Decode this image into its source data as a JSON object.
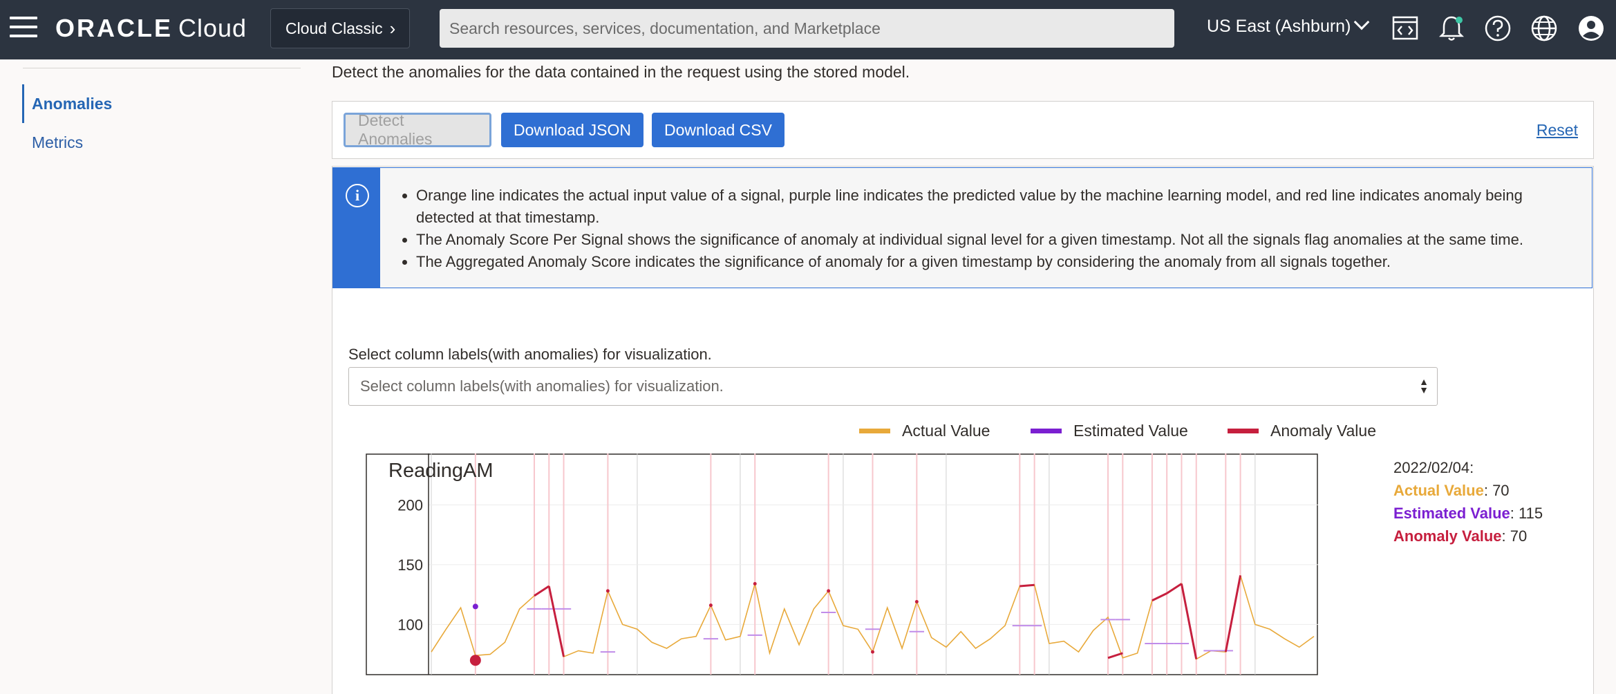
{
  "header": {
    "brand": "ORACLE",
    "product": "Cloud",
    "cloud_classic": "Cloud Classic",
    "search_placeholder": "Search resources, services, documentation, and Marketplace",
    "region": "US East (Ashburn)",
    "icons": [
      "menu-icon",
      "code-editor-icon",
      "bell-icon",
      "help-icon",
      "globe-icon",
      "user-icon"
    ]
  },
  "sidebar": {
    "items": [
      {
        "label": "Anomalies",
        "active": true
      },
      {
        "label": "Metrics",
        "active": false
      }
    ]
  },
  "main": {
    "description": "Detect the anomalies for the data contained in the request using the stored model.",
    "buttons": {
      "detect": "Detect Anomalies",
      "download_json": "Download JSON",
      "download_csv": "Download CSV",
      "reset": "Reset"
    },
    "info": [
      "Orange line indicates the actual input value of a signal, purple line indicates the predicted value by the machine learning model, and red line indicates anomaly being detected at that timestamp.",
      "The Anomaly Score Per Signal shows the significance of anomaly at individual signal level for a given timestamp. Not all the signals flag anomalies at the same time.",
      "The Aggregated Anomaly Score indicates the significance of anomaly for a given timestamp by considering the anomaly from all signals together."
    ],
    "select_label": "Select column labels(with anomalies) for visualization.",
    "select_placeholder": "Select column labels(with anomalies) for visualization."
  },
  "legend": {
    "actual": "Actual Value",
    "estimated": "Estimated Value",
    "anomaly": "Anomaly Value"
  },
  "colors": {
    "actual": "#e8a93a",
    "estimated": "#7b1fd1",
    "anomaly": "#c61f3e",
    "primary": "#2f6fd3"
  },
  "readout": {
    "date": "2022/02/04:",
    "actual_label": "Actual Value",
    "actual_value": ": 70",
    "estimated_label": "Estimated Value",
    "estimated_value": ": 115",
    "anomaly_label": "Anomaly Value",
    "anomaly_value": ": 70"
  },
  "chart_data": {
    "type": "line",
    "title": "ReadingAM",
    "xlabel": "",
    "ylabel": "",
    "ylim": [
      58,
      243
    ],
    "yticks": [
      100,
      150,
      200
    ],
    "grid": true,
    "series": [
      {
        "name": "Actual Value",
        "values": [
          77,
          96,
          114,
          74,
          75,
          85,
          113,
          124,
          132,
          73,
          78,
          76,
          128,
          100,
          96,
          85,
          80,
          88,
          90,
          116,
          87,
          90,
          134,
          76,
          113,
          83,
          113,
          128,
          99,
          96,
          77,
          114,
          80,
          119,
          89,
          81,
          94,
          80,
          88,
          99,
          132,
          133,
          84,
          86,
          77,
          95,
          106,
          72,
          76,
          120,
          126,
          134,
          71,
          78,
          77,
          141,
          100,
          96,
          88,
          81,
          90
        ]
      },
      {
        "name": "Estimated Value",
        "values": [
          null,
          null,
          null,
          115,
          null,
          null,
          null,
          113,
          113,
          113,
          null,
          null,
          77,
          null,
          null,
          null,
          null,
          null,
          null,
          88,
          null,
          null,
          91,
          null,
          null,
          null,
          null,
          110,
          null,
          null,
          96,
          null,
          null,
          94,
          null,
          null,
          null,
          null,
          null,
          null,
          99,
          99,
          null,
          null,
          null,
          null,
          104,
          104,
          null,
          84,
          84,
          84,
          null,
          78,
          78,
          null,
          null,
          null,
          null,
          null,
          null
        ]
      },
      {
        "name": "Anomaly Value",
        "values": [
          null,
          null,
          null,
          70,
          null,
          null,
          null,
          124,
          132,
          73,
          null,
          null,
          128,
          null,
          null,
          null,
          null,
          null,
          null,
          116,
          null,
          null,
          134,
          null,
          null,
          null,
          null,
          128,
          null,
          null,
          77,
          null,
          null,
          119,
          null,
          null,
          null,
          null,
          null,
          null,
          132,
          133,
          null,
          null,
          null,
          null,
          72,
          76,
          null,
          120,
          126,
          134,
          71,
          null,
          77,
          141,
          null,
          null,
          null,
          null,
          null
        ]
      }
    ],
    "anomaly_indices": [
      3,
      7,
      8,
      9,
      12,
      19,
      22,
      27,
      30,
      33,
      40,
      41,
      46,
      47,
      49,
      50,
      51,
      52,
      54,
      55
    ]
  }
}
